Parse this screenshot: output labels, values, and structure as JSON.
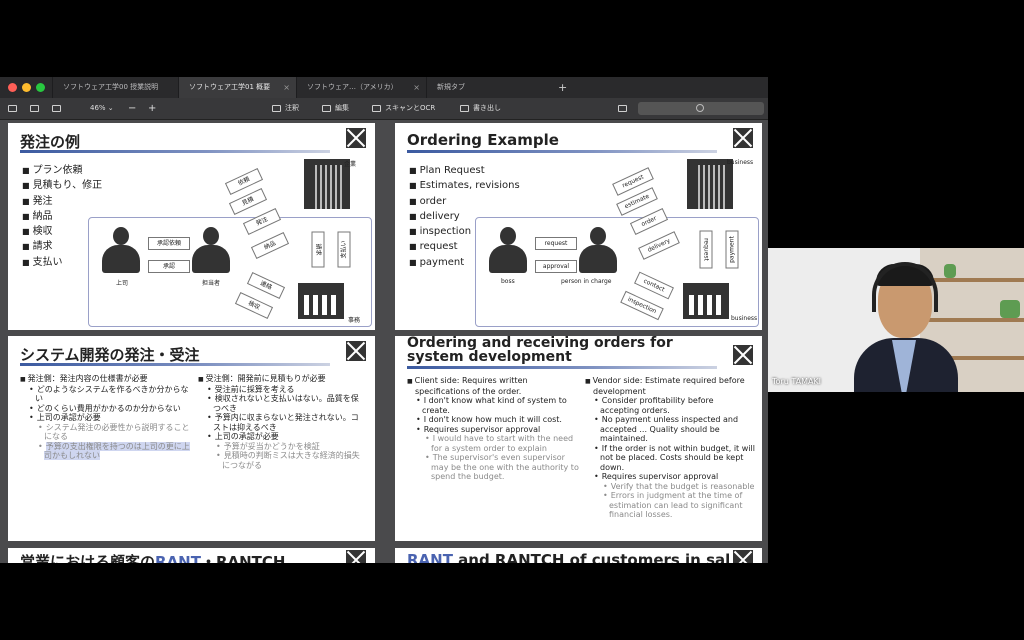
{
  "window": {
    "tabs": [
      {
        "label": "ソフトウェア工学00 授業説明",
        "active": false
      },
      {
        "label": "ソフトウェア工学01 概要",
        "active": true
      },
      {
        "label": "ソフトウェア…（アメリカ）",
        "active": false
      },
      {
        "label": "新規タブ",
        "active": false
      }
    ],
    "new_tab": "+",
    "zoom": "46%",
    "zoom_out": "−",
    "zoom_in": "+",
    "tools": {
      "annotate": "注釈",
      "edit": "編集",
      "scan": "スキャンとOCR",
      "export": "書き出し"
    }
  },
  "slides": {
    "ordering_jp": {
      "title": "発注の例",
      "items": [
        "プラン依頼",
        "見積もり、修正",
        "発注",
        "納品",
        "検収",
        "請求",
        "支払い"
      ],
      "boss": "上司",
      "person": "担当者",
      "company": "企業",
      "office": "事務",
      "arrows": {
        "request": "承認依頼",
        "approval": "承認",
        "plan": "依頼",
        "estimate": "見積",
        "order": "発注",
        "delivery": "納品",
        "invoice": "請求",
        "payment": "支払い",
        "contact": "連絡",
        "inspection": "検収"
      }
    },
    "ordering_en": {
      "title": "Ordering Example",
      "items": [
        "Plan Request",
        "Estimates, revisions",
        "order",
        "delivery",
        "inspection",
        "request",
        "payment"
      ],
      "boss": "boss",
      "person": "person in charge",
      "company": "business",
      "office": "business",
      "arrows": {
        "request": "request",
        "approval": "approval",
        "plan": "request",
        "estimate": "estimate",
        "order": "order",
        "delivery": "delivery",
        "invoice": "request",
        "payment": "payment",
        "contact": "contact",
        "inspection": "inspection"
      }
    },
    "system_jp": {
      "title": "システム開発の発注・受注",
      "left": {
        "head": "発注側：発注内容の仕様書が必要",
        "b1": "どのようなシステムを作るべきか分からない",
        "b2": "どのくらい費用がかかるのか分からない",
        "b3": "上司の承認が必要",
        "s1": "システム発注の必要性から説明することになる",
        "s2": "予算の支出権限を持つのは上司の更に上司かもしれない"
      },
      "right": {
        "head": "受注側：開発前に見積もりが必要",
        "b1": "受注前に採算を考える",
        "b2": "検収されないと支払いはない。品質を保つべき",
        "b3": "予算内に収まらないと発注されない。コストは抑えるべき",
        "b4": "上司の承認が必要",
        "s1": "予算が妥当かどうかを検証",
        "s2": "見積時の判断ミスは大きな経済的損失につながる"
      }
    },
    "system_en": {
      "title_line1": "Ordering and receiving orders for",
      "title_line2": "system development",
      "left": {
        "head": "Client side: Requires written specifications of the order.",
        "b1": "I don't know what kind of system to create.",
        "b2": "I don't know how much it will cost.",
        "b3": "Requires supervisor approval",
        "s1": "I would have to start with the need for a system order to explain",
        "s2": "The supervisor's even supervisor may be the one with the authority to spend the budget."
      },
      "right": {
        "head": "Vendor side: Estimate required before development",
        "b1": "Consider profitability before accepting orders.",
        "b2": "No payment unless inspected and accepted ... Quality should be maintained.",
        "b3": "If the order is not within budget, it will not be placed. Costs should be kept down.",
        "b4": "Requires supervisor approval",
        "s1": "Verify that the budget is reasonable",
        "s2": "Errors in judgment at the time of estimation can lead to significant financial losses."
      }
    },
    "peek_jp": {
      "pre": "営業における顧客の",
      "rant": "RANT",
      "post": "・RANTCH"
    },
    "peek_en": {
      "rant": "RANT",
      "post": " and RANTCH of customers in sal"
    }
  },
  "video": {
    "name": "Toru TAMAKI"
  },
  "colors": {
    "accent": "#3b5aa0",
    "tab_active": "#3b3b3d",
    "traffic_red": "#ff5f57",
    "traffic_yellow": "#febc2e",
    "traffic_green": "#28c840"
  }
}
